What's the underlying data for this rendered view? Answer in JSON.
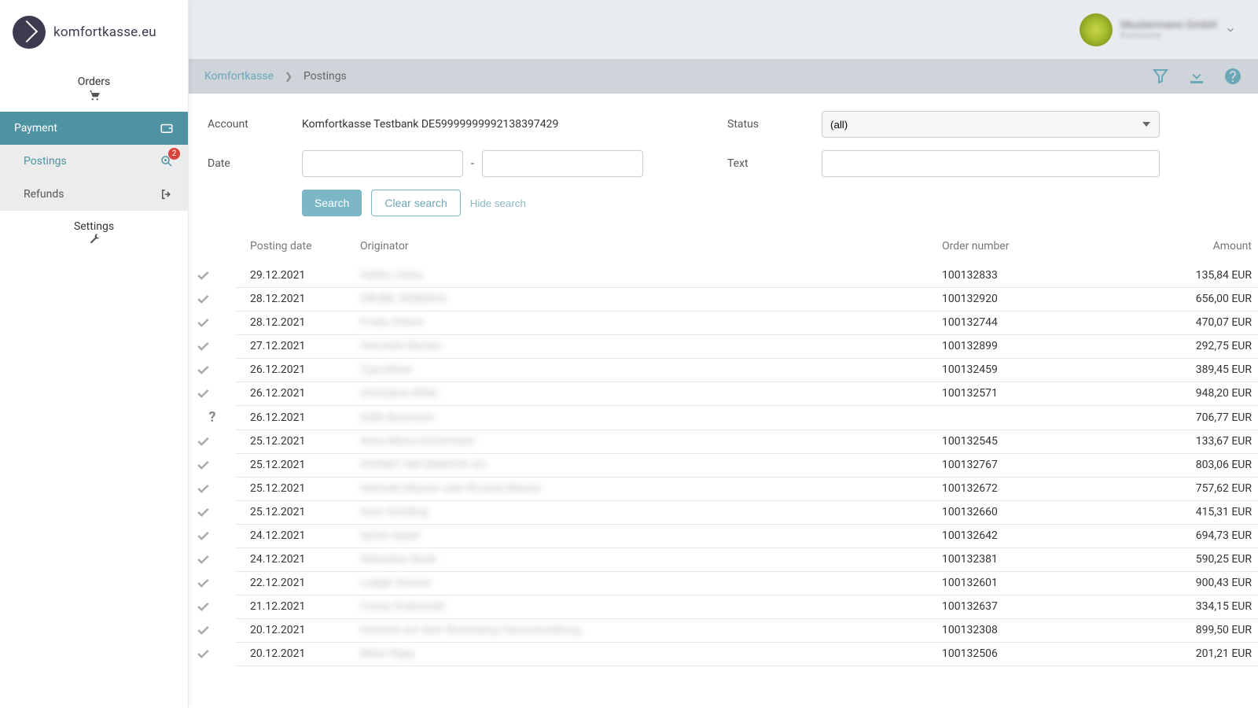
{
  "brand": {
    "name": "komfortkasse.eu"
  },
  "header": {
    "account_name": "Mustermann GmbH",
    "account_sub": "Kontoname"
  },
  "sidebar": {
    "orders": "Orders",
    "payment": "Payment",
    "postings": "Postings",
    "refunds": "Refunds",
    "settings": "Settings",
    "badge": "2"
  },
  "breadcrumb": {
    "root": "Komfortkasse",
    "current": "Postings"
  },
  "filters": {
    "account_label": "Account",
    "account_value": "Komfortkasse Testbank DE59999999992138397429",
    "date_label": "Date",
    "status_label": "Status",
    "status_value": "(all)",
    "text_label": "Text",
    "search": "Search",
    "clear": "Clear search",
    "hide": "Hide search"
  },
  "columns": {
    "posting_date": "Posting date",
    "originator": "Originator",
    "order_number": "Order number",
    "amount": "Amount"
  },
  "rows": [
    {
      "status": "check",
      "date": "29.12.2021",
      "originator": "Hallen, Greta",
      "order": "100132833",
      "amount": "135,84 EUR"
    },
    {
      "status": "check",
      "date": "28.12.2021",
      "originator": "GRUBE, REBEKKA",
      "order": "100132920",
      "amount": "656,00 EUR"
    },
    {
      "status": "check",
      "date": "28.12.2021",
      "originator": "Friske Online",
      "order": "100132744",
      "amount": "470,07 EUR"
    },
    {
      "status": "check",
      "date": "27.12.2021",
      "originator": "Henriette Becker",
      "order": "100132899",
      "amount": "292,75 EUR"
    },
    {
      "status": "check",
      "date": "26.12.2021",
      "originator": "Cyprothias",
      "order": "100132459",
      "amount": "389,45 EUR"
    },
    {
      "status": "check",
      "date": "26.12.2021",
      "originator": "Christiane Witte",
      "order": "100132571",
      "amount": "948,20 EUR"
    },
    {
      "status": "question",
      "date": "26.12.2021",
      "originator": "Edith Baumann",
      "order": "",
      "amount": "706,77 EUR"
    },
    {
      "status": "check",
      "date": "25.12.2021",
      "originator": "Anna-Maria Schürmann",
      "order": "100132545",
      "amount": "133,67 EUR"
    },
    {
      "status": "check",
      "date": "25.12.2021",
      "originator": "POPNET INFORMATIK AG",
      "order": "100132767",
      "amount": "803,06 EUR"
    },
    {
      "status": "check",
      "date": "25.12.2021",
      "originator": "Helmuth Maurer oder Ricarda Maurer",
      "order": "100132672",
      "amount": "757,62 EUR"
    },
    {
      "status": "check",
      "date": "25.12.2021",
      "originator": "Sven Schilling",
      "order": "100132660",
      "amount": "415,31 EUR"
    },
    {
      "status": "check",
      "date": "24.12.2021",
      "originator": "Sylvia Appel",
      "order": "100132642",
      "amount": "694,73 EUR"
    },
    {
      "status": "check",
      "date": "24.12.2021",
      "originator": "Sebastian Bode",
      "order": "100132381",
      "amount": "590,25 EUR"
    },
    {
      "status": "check",
      "date": "22.12.2021",
      "originator": "Ludger Krause",
      "order": "100132601",
      "amount": "900,43 EUR"
    },
    {
      "status": "check",
      "date": "21.12.2021",
      "originator": "Conny Grabowski",
      "order": "100132637",
      "amount": "334,15 EUR"
    },
    {
      "status": "check",
      "date": "20.12.2021",
      "originator": "Institute auf dem Rosenberg Hausverwaltung",
      "order": "100132308",
      "amount": "899,50 EUR"
    },
    {
      "status": "check",
      "date": "20.12.2021",
      "originator": "Milan Rapp",
      "order": "100132506",
      "amount": "201,21 EUR"
    }
  ]
}
